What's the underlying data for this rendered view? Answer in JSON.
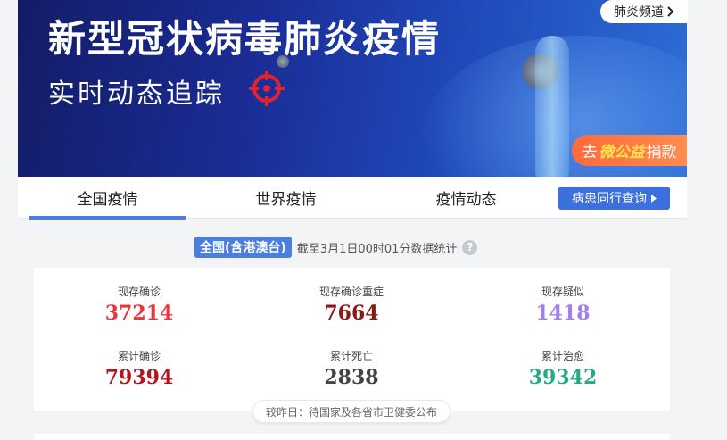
{
  "banner": {
    "title": "新型冠状病毒肺炎疫情",
    "subtitle": "实时动态追踪",
    "channel_link": "肺炎频道",
    "donate_prefix": "去",
    "donate_wx": "微公益",
    "donate_suffix": "捐款"
  },
  "tabs": [
    {
      "label": "全国疫情",
      "active": true
    },
    {
      "label": "世界疫情",
      "active": false
    },
    {
      "label": "疫情动态",
      "active": false
    }
  ],
  "query_button": "病患同行查询",
  "stats_header": {
    "region": "全国(含港澳台)",
    "as_of": "截至3月1日00时01分数据统计"
  },
  "stats": [
    {
      "label": "现存确诊",
      "value": "37214",
      "color": "#e8373c"
    },
    {
      "label": "现存确诊重症",
      "value": "7664",
      "color": "#8a1a1a"
    },
    {
      "label": "现存疑似",
      "value": "1418",
      "color": "#a27ef0"
    },
    {
      "label": "累计确诊",
      "value": "79394",
      "color": "#b5141d"
    },
    {
      "label": "累计死亡",
      "value": "2838",
      "color": "#444444"
    },
    {
      "label": "累计治愈",
      "value": "39342",
      "color": "#27a88b"
    }
  ],
  "note": "较昨日：待国家及各省市卫健委公布",
  "icons": {
    "target": "target-crosshair-icon",
    "chevron": "chevron-right-icon",
    "help": "question-icon"
  }
}
